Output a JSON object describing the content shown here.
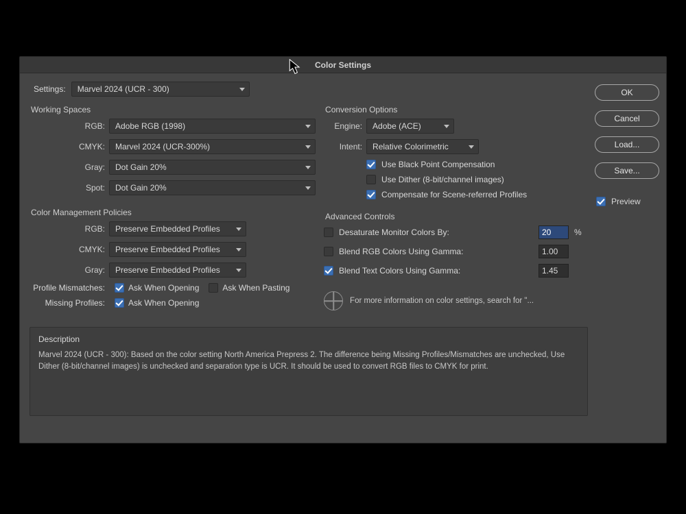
{
  "dialog": {
    "title": "Color Settings",
    "settings_label": "Settings:",
    "settings_value": "Marvel 2024 (UCR - 300)"
  },
  "buttons": {
    "ok": "OK",
    "cancel": "Cancel",
    "load": "Load...",
    "save": "Save...",
    "preview": "Preview"
  },
  "working_spaces": {
    "title": "Working Spaces",
    "rgb_label": "RGB:",
    "rgb_value": "Adobe RGB (1998)",
    "cmyk_label": "CMYK:",
    "cmyk_value": "Marvel 2024 (UCR-300%)",
    "gray_label": "Gray:",
    "gray_value": "Dot Gain 20%",
    "spot_label": "Spot:",
    "spot_value": "Dot Gain 20%"
  },
  "policies": {
    "title": "Color Management Policies",
    "rgb_label": "RGB:",
    "rgb_value": "Preserve Embedded Profiles",
    "cmyk_label": "CMYK:",
    "cmyk_value": "Preserve Embedded Profiles",
    "gray_label": "Gray:",
    "gray_value": "Preserve Embedded Profiles",
    "mismatches_label": "Profile Mismatches:",
    "ask_opening": "Ask When Opening",
    "ask_pasting": "Ask When Pasting",
    "missing_label": "Missing Profiles:"
  },
  "conversion": {
    "title": "Conversion Options",
    "engine_label": "Engine:",
    "engine_value": "Adobe (ACE)",
    "intent_label": "Intent:",
    "intent_value": "Relative Colorimetric",
    "black_point": "Use Black Point Compensation",
    "dither": "Use Dither (8-bit/channel images)",
    "scene": "Compensate for Scene-referred Profiles"
  },
  "advanced": {
    "title": "Advanced Controls",
    "desat": "Desaturate Monitor Colors By:",
    "desat_value": "20",
    "desat_unit": "%",
    "blend_rgb": "Blend RGB Colors Using Gamma:",
    "blend_rgb_value": "1.00",
    "blend_text": "Blend Text Colors Using Gamma:",
    "blend_text_value": "1.45"
  },
  "info": {
    "text": "For more information on color settings, search for \"..."
  },
  "description": {
    "title": "Description",
    "body": "Marvel 2024 (UCR - 300):  Based on the color setting North America Prepress 2. The difference being Missing Profiles/Mismatches are unchecked, Use Dither (8-bit/channel images) is unchecked and separation type is UCR. It should be used to convert RGB files to CMYK for print."
  }
}
